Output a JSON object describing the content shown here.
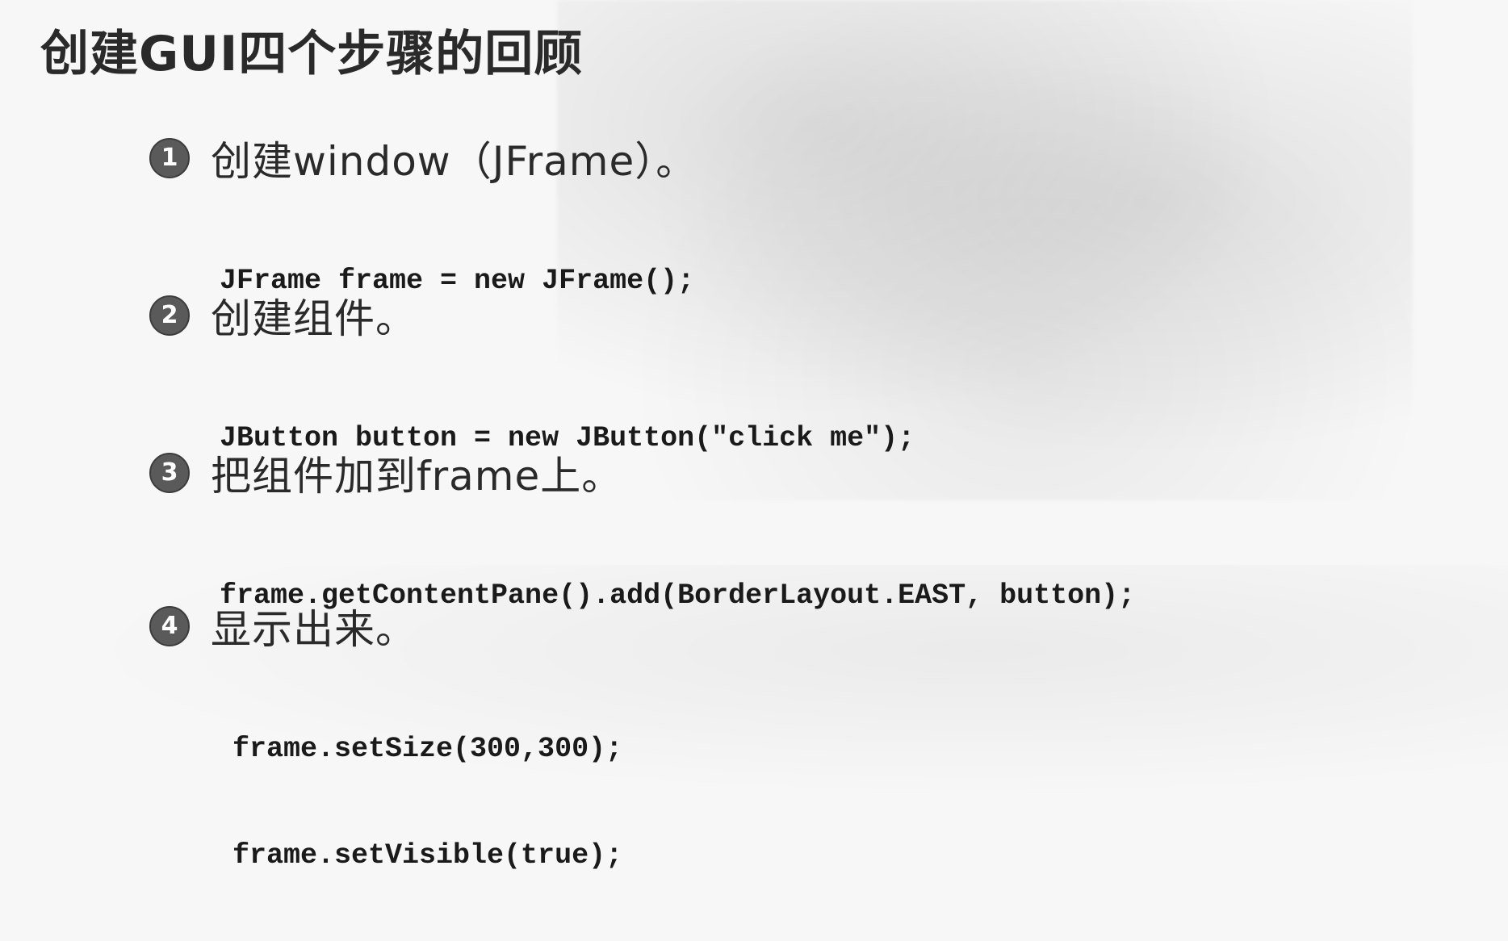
{
  "title": "创建GUI四个步骤的回顾",
  "steps": [
    {
      "number": "1",
      "heading": "创建window（JFrame）。",
      "code": [
        "JFrame frame = new JFrame();"
      ]
    },
    {
      "number": "2",
      "heading": "创建组件。",
      "code": [
        "JButton button = new JButton(\"click me\");"
      ]
    },
    {
      "number": "3",
      "heading": "把组件加到frame上。",
      "code": [
        "frame.getContentPane().add(BorderLayout.EAST, button);"
      ]
    },
    {
      "number": "4",
      "heading": "显示出来。",
      "code": [
        "frame.setSize(300,300);",
        "frame.setVisible(true);"
      ]
    }
  ]
}
